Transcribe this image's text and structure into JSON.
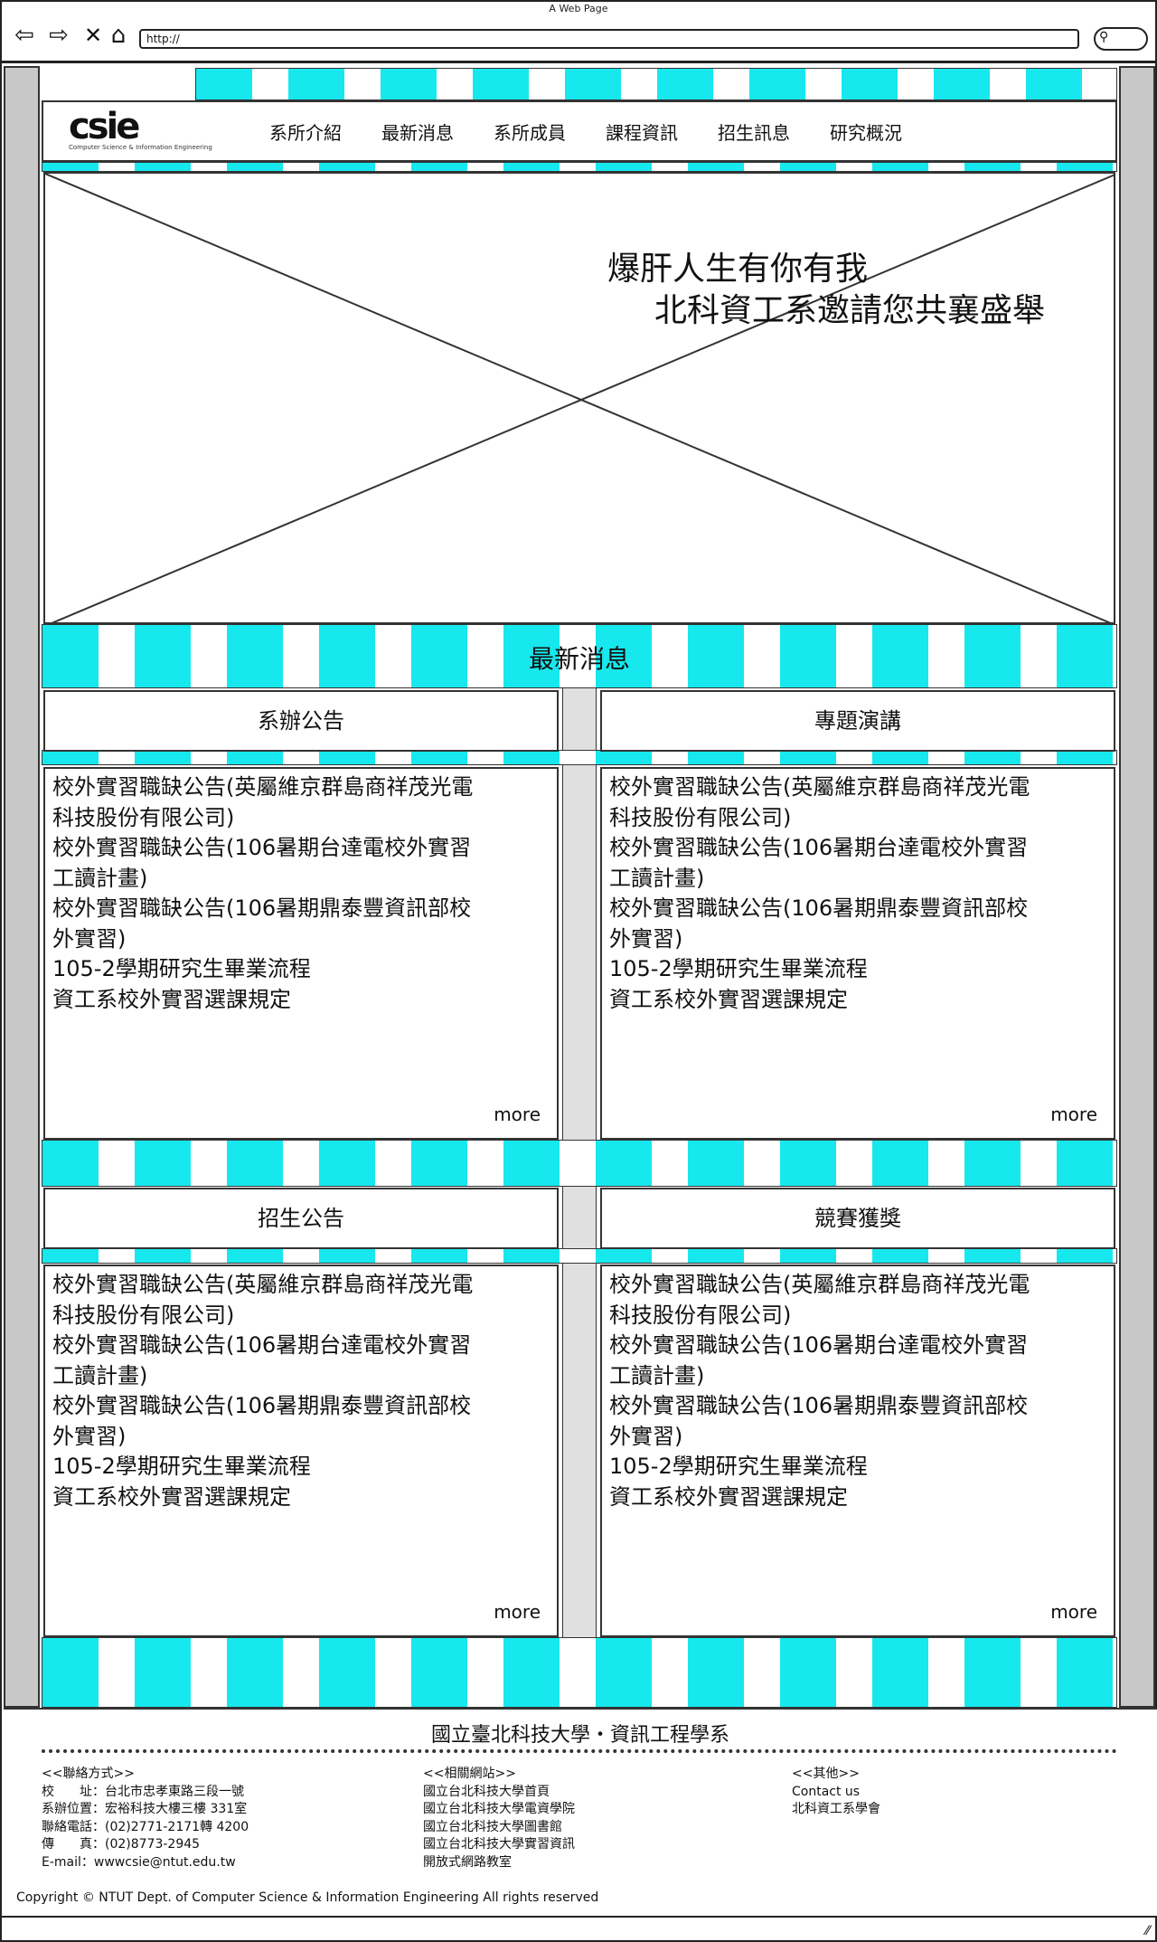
{
  "browser": {
    "title": "A Web Page",
    "url": "http://",
    "back_icon": "arrow-left-icon",
    "forward_icon": "arrow-right-icon",
    "close_icon": "close-icon",
    "home_icon": "home-icon",
    "search_icon": "search-icon"
  },
  "logo": {
    "mark": "csie",
    "subtitle": "Computer Science & Information Engineering"
  },
  "nav": {
    "items": [
      "系所介紹",
      "最新消息",
      "系所成員",
      "課程資訊",
      "招生訊息",
      "研究概況"
    ]
  },
  "hero": {
    "line1": "爆肝人生有你有我",
    "line2": "北科資工系邀請您共襄盛舉"
  },
  "news": {
    "section_title": "最新消息",
    "more_label": "more",
    "cards": [
      {
        "title": "系辦公告",
        "items": [
          "校外實習職缺公告(英屬維京群島商祥茂光電",
          "科技股份有限公司)",
          "校外實習職缺公告(106暑期台達電校外實習",
          "工讀計畫)",
          "校外實習職缺公告(106暑期鼎泰豐資訊部校",
          "外實習)",
          "105-2學期研究生畢業流程",
          "資工系校外實習選課規定"
        ]
      },
      {
        "title": "專題演講",
        "items": [
          "校外實習職缺公告(英屬維京群島商祥茂光電",
          "科技股份有限公司)",
          "校外實習職缺公告(106暑期台達電校外實習",
          "工讀計畫)",
          "校外實習職缺公告(106暑期鼎泰豐資訊部校",
          "外實習)",
          "105-2學期研究生畢業流程",
          "資工系校外實習選課規定"
        ]
      },
      {
        "title": "招生公告",
        "items": [
          "校外實習職缺公告(英屬維京群島商祥茂光電",
          "科技股份有限公司)",
          "校外實習職缺公告(106暑期台達電校外實習",
          "工讀計畫)",
          "校外實習職缺公告(106暑期鼎泰豐資訊部校",
          "外實習)",
          "105-2學期研究生畢業流程",
          "資工系校外實習選課規定"
        ]
      },
      {
        "title": "競賽獲獎",
        "items": [
          "校外實習職缺公告(英屬維京群島商祥茂光電",
          "科技股份有限公司)",
          "校外實習職缺公告(106暑期台達電校外實習",
          "工讀計畫)",
          "校外實習職缺公告(106暑期鼎泰豐資訊部校",
          "外實習)",
          "105-2學期研究生畢業流程",
          "資工系校外實習選課規定"
        ]
      }
    ]
  },
  "footer": {
    "title": "國立臺北科技大學‧資訊工程學系",
    "contact": {
      "heading": "<<聯絡方式>>",
      "lines": [
        "校　　址：台北市忠孝東路三段一號",
        "系辦位置：宏裕科技大樓三樓 331室",
        "聯絡電話：(02)2771-2171轉 4200",
        "傳　　真：(02)8773-2945",
        "E-mail：wwwcsie@ntut.edu.tw"
      ]
    },
    "links": {
      "heading": "<<相關網站>>",
      "items": [
        "國立台北科技大學首頁",
        "國立台北科技大學電資學院",
        "國立台北科技大學圖書館",
        "國立台北科技大學實習資訊",
        "開放式網路教室"
      ]
    },
    "other": {
      "heading": "<<其他>>",
      "items": [
        "Contact us",
        "北科資工系學會"
      ]
    },
    "copyright": "Copyright © NTUT Dept. of Computer Science & Information Engineering All rights reserved"
  },
  "colors": {
    "stripe_cyan": "#17e8ee",
    "gutter_gray": "#c8c8c8"
  }
}
